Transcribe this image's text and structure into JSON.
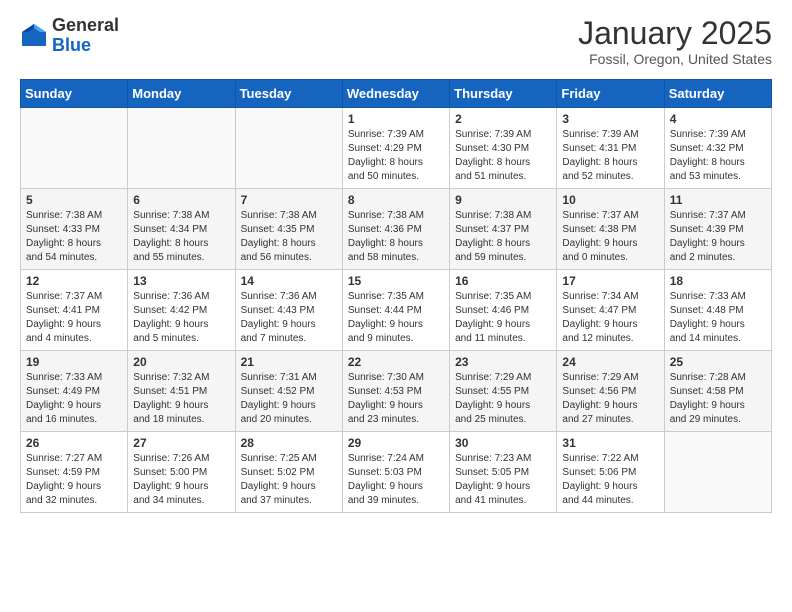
{
  "logo": {
    "general": "General",
    "blue": "Blue"
  },
  "header": {
    "month": "January 2025",
    "location": "Fossil, Oregon, United States"
  },
  "weekdays": [
    "Sunday",
    "Monday",
    "Tuesday",
    "Wednesday",
    "Thursday",
    "Friday",
    "Saturday"
  ],
  "weeks": [
    [
      {
        "day": "",
        "info": ""
      },
      {
        "day": "",
        "info": ""
      },
      {
        "day": "",
        "info": ""
      },
      {
        "day": "1",
        "info": "Sunrise: 7:39 AM\nSunset: 4:29 PM\nDaylight: 8 hours\nand 50 minutes."
      },
      {
        "day": "2",
        "info": "Sunrise: 7:39 AM\nSunset: 4:30 PM\nDaylight: 8 hours\nand 51 minutes."
      },
      {
        "day": "3",
        "info": "Sunrise: 7:39 AM\nSunset: 4:31 PM\nDaylight: 8 hours\nand 52 minutes."
      },
      {
        "day": "4",
        "info": "Sunrise: 7:39 AM\nSunset: 4:32 PM\nDaylight: 8 hours\nand 53 minutes."
      }
    ],
    [
      {
        "day": "5",
        "info": "Sunrise: 7:38 AM\nSunset: 4:33 PM\nDaylight: 8 hours\nand 54 minutes."
      },
      {
        "day": "6",
        "info": "Sunrise: 7:38 AM\nSunset: 4:34 PM\nDaylight: 8 hours\nand 55 minutes."
      },
      {
        "day": "7",
        "info": "Sunrise: 7:38 AM\nSunset: 4:35 PM\nDaylight: 8 hours\nand 56 minutes."
      },
      {
        "day": "8",
        "info": "Sunrise: 7:38 AM\nSunset: 4:36 PM\nDaylight: 8 hours\nand 58 minutes."
      },
      {
        "day": "9",
        "info": "Sunrise: 7:38 AM\nSunset: 4:37 PM\nDaylight: 8 hours\nand 59 minutes."
      },
      {
        "day": "10",
        "info": "Sunrise: 7:37 AM\nSunset: 4:38 PM\nDaylight: 9 hours\nand 0 minutes."
      },
      {
        "day": "11",
        "info": "Sunrise: 7:37 AM\nSunset: 4:39 PM\nDaylight: 9 hours\nand 2 minutes."
      }
    ],
    [
      {
        "day": "12",
        "info": "Sunrise: 7:37 AM\nSunset: 4:41 PM\nDaylight: 9 hours\nand 4 minutes."
      },
      {
        "day": "13",
        "info": "Sunrise: 7:36 AM\nSunset: 4:42 PM\nDaylight: 9 hours\nand 5 minutes."
      },
      {
        "day": "14",
        "info": "Sunrise: 7:36 AM\nSunset: 4:43 PM\nDaylight: 9 hours\nand 7 minutes."
      },
      {
        "day": "15",
        "info": "Sunrise: 7:35 AM\nSunset: 4:44 PM\nDaylight: 9 hours\nand 9 minutes."
      },
      {
        "day": "16",
        "info": "Sunrise: 7:35 AM\nSunset: 4:46 PM\nDaylight: 9 hours\nand 11 minutes."
      },
      {
        "day": "17",
        "info": "Sunrise: 7:34 AM\nSunset: 4:47 PM\nDaylight: 9 hours\nand 12 minutes."
      },
      {
        "day": "18",
        "info": "Sunrise: 7:33 AM\nSunset: 4:48 PM\nDaylight: 9 hours\nand 14 minutes."
      }
    ],
    [
      {
        "day": "19",
        "info": "Sunrise: 7:33 AM\nSunset: 4:49 PM\nDaylight: 9 hours\nand 16 minutes."
      },
      {
        "day": "20",
        "info": "Sunrise: 7:32 AM\nSunset: 4:51 PM\nDaylight: 9 hours\nand 18 minutes."
      },
      {
        "day": "21",
        "info": "Sunrise: 7:31 AM\nSunset: 4:52 PM\nDaylight: 9 hours\nand 20 minutes."
      },
      {
        "day": "22",
        "info": "Sunrise: 7:30 AM\nSunset: 4:53 PM\nDaylight: 9 hours\nand 23 minutes."
      },
      {
        "day": "23",
        "info": "Sunrise: 7:29 AM\nSunset: 4:55 PM\nDaylight: 9 hours\nand 25 minutes."
      },
      {
        "day": "24",
        "info": "Sunrise: 7:29 AM\nSunset: 4:56 PM\nDaylight: 9 hours\nand 27 minutes."
      },
      {
        "day": "25",
        "info": "Sunrise: 7:28 AM\nSunset: 4:58 PM\nDaylight: 9 hours\nand 29 minutes."
      }
    ],
    [
      {
        "day": "26",
        "info": "Sunrise: 7:27 AM\nSunset: 4:59 PM\nDaylight: 9 hours\nand 32 minutes."
      },
      {
        "day": "27",
        "info": "Sunrise: 7:26 AM\nSunset: 5:00 PM\nDaylight: 9 hours\nand 34 minutes."
      },
      {
        "day": "28",
        "info": "Sunrise: 7:25 AM\nSunset: 5:02 PM\nDaylight: 9 hours\nand 37 minutes."
      },
      {
        "day": "29",
        "info": "Sunrise: 7:24 AM\nSunset: 5:03 PM\nDaylight: 9 hours\nand 39 minutes."
      },
      {
        "day": "30",
        "info": "Sunrise: 7:23 AM\nSunset: 5:05 PM\nDaylight: 9 hours\nand 41 minutes."
      },
      {
        "day": "31",
        "info": "Sunrise: 7:22 AM\nSunset: 5:06 PM\nDaylight: 9 hours\nand 44 minutes."
      },
      {
        "day": "",
        "info": ""
      }
    ]
  ]
}
